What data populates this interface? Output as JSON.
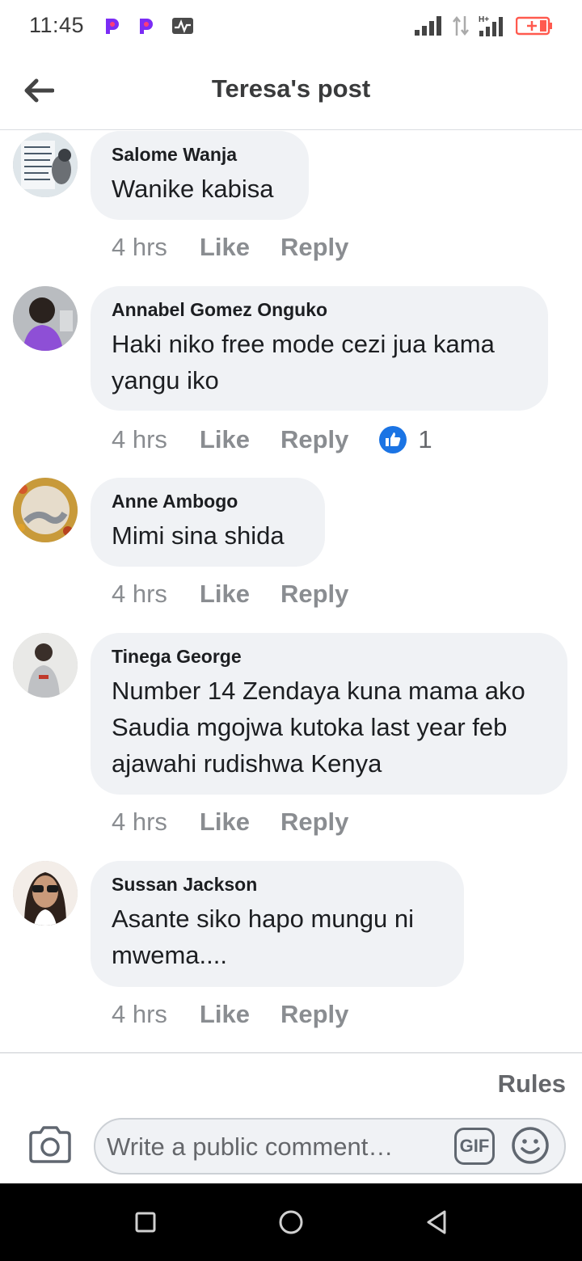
{
  "status_bar": {
    "time": "11:45",
    "app_icons": [
      "p-app-icon",
      "p-app-icon",
      "pulse-icon"
    ],
    "indicators": [
      "signal-icon",
      "data-arrows-icon",
      "hplus-signal-icon",
      "battery-charging-icon"
    ],
    "hplus_label": "H+"
  },
  "header": {
    "title": "Teresa's post",
    "back_icon": "back-arrow-icon"
  },
  "comments": [
    {
      "author": "Salome Wanja",
      "text": "Wanike kabisa",
      "time": "4 hrs",
      "like": "Like",
      "reply": "Reply"
    },
    {
      "author": "Annabel Gomez Onguko",
      "text": "Haki niko free mode cezi jua kama yangu iko",
      "time": "4 hrs",
      "like": "Like",
      "reply": "Reply",
      "reactions": "1"
    },
    {
      "author": "Anne Ambogo",
      "text": "Mimi sina shida",
      "time": "4 hrs",
      "like": "Like",
      "reply": "Reply"
    },
    {
      "author": "Tinega George",
      "text": "Number 14 Zendaya kuna mama ako Saudia mgojwa kutoka last year feb ajawahi rudishwa Kenya",
      "time": "4 hrs",
      "like": "Like",
      "reply": "Reply"
    },
    {
      "author": "Sussan Jackson",
      "text": "Asante siko hapo mungu ni mwema....",
      "time": "4 hrs",
      "like": "Like",
      "reply": "Reply"
    }
  ],
  "footer": {
    "rules": "Rules",
    "placeholder": "Write a public comment…",
    "gif": "GIF"
  },
  "colors": {
    "bubble": "#f0f2f5",
    "action_text": "#8a8d91",
    "like_blue": "#1b74e4",
    "battery": "#ff5a4f",
    "app_icon": "#7b2cf5"
  }
}
